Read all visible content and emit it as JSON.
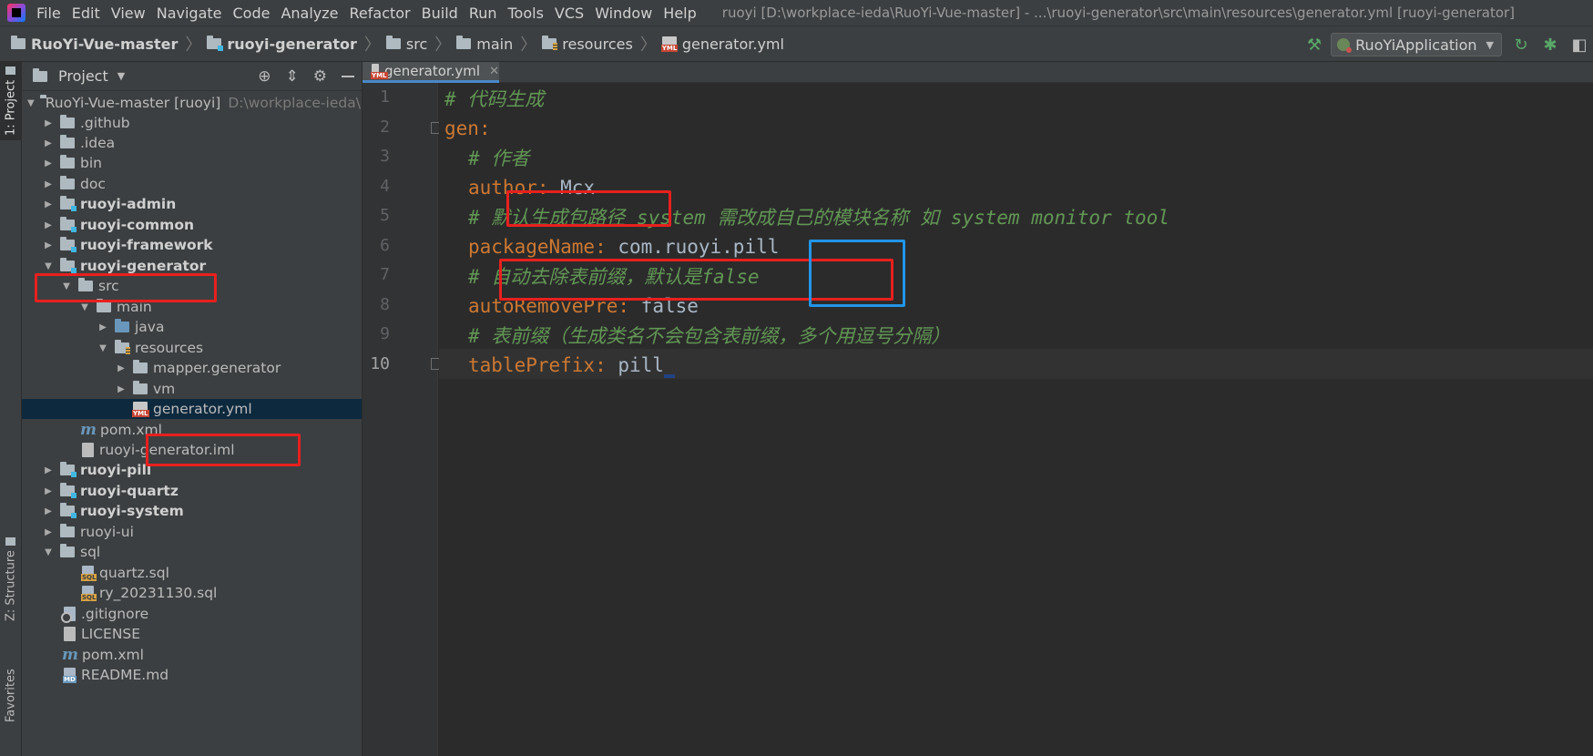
{
  "window": {
    "title": "ruoyi [D:\\workplace-ieda\\RuoYi-Vue-master] - ...\\ruoyi-generator\\src\\main\\resources\\generator.yml [ruoyi-generator]"
  },
  "menu": [
    "File",
    "Edit",
    "View",
    "Navigate",
    "Code",
    "Analyze",
    "Refactor",
    "Build",
    "Run",
    "Tools",
    "VCS",
    "Window",
    "Help"
  ],
  "breadcrumb": [
    "RuoYi-Vue-master",
    "ruoyi-generator",
    "src",
    "main",
    "resources",
    "generator.yml"
  ],
  "run_config": "RuoYiApplication",
  "tool_tabs": {
    "project": "1: Project",
    "structure": "Z: Structure",
    "favorites": "Favorites"
  },
  "project_panel": {
    "title": "Project",
    "root": {
      "label": "RuoYi-Vue-master [ruoyi]",
      "path": "D:\\workplace-ieda\\RuoYi-Vue-master"
    },
    "items": [
      ".github",
      ".idea",
      "bin",
      "doc",
      "ruoyi-admin",
      "ruoyi-common",
      "ruoyi-framework",
      "ruoyi-generator",
      "src",
      "main",
      "java",
      "resources",
      "mapper.generator",
      "vm",
      "generator.yml",
      "pom.xml",
      "ruoyi-generator.iml",
      "ruoyi-pill",
      "ruoyi-quartz",
      "ruoyi-system",
      "ruoyi-ui",
      "sql",
      "quartz.sql",
      "ry_20231130.sql",
      ".gitignore",
      "LICENSE",
      "pom.xml",
      "README.md"
    ]
  },
  "editor": {
    "tab": "generator.yml",
    "current_line": 10,
    "lines": [
      {
        "n": "1",
        "comment": "# 代码生成"
      },
      {
        "n": "2",
        "key": "gen",
        "sep": ":"
      },
      {
        "n": "3",
        "comment": "# 作者"
      },
      {
        "n": "4",
        "key": "author",
        "sep": ": ",
        "value": "Mcx"
      },
      {
        "n": "5",
        "comment": "# 默认生成包路径 system 需改成自己的模块名称 如 system monitor tool"
      },
      {
        "n": "6",
        "key": "packageName",
        "sep": ": ",
        "value": "com.ruoyi.pill"
      },
      {
        "n": "7",
        "comment": "# 自动去除表前缀，默认是false"
      },
      {
        "n": "8",
        "key": "autoRemovePre",
        "sep": ": ",
        "value": "false"
      },
      {
        "n": "9",
        "comment": "# 表前缀（生成类名不会包含表前缀，多个用逗号分隔）"
      },
      {
        "n": "10",
        "key": "tablePrefix",
        "sep": ": ",
        "value": "pill"
      }
    ]
  },
  "colors": {
    "annotation_red": "#e8201e",
    "annotation_blue": "#2295e8",
    "comment": "#629755",
    "yaml_key": "#cc7832",
    "yaml_value": "#a9b7c6"
  }
}
